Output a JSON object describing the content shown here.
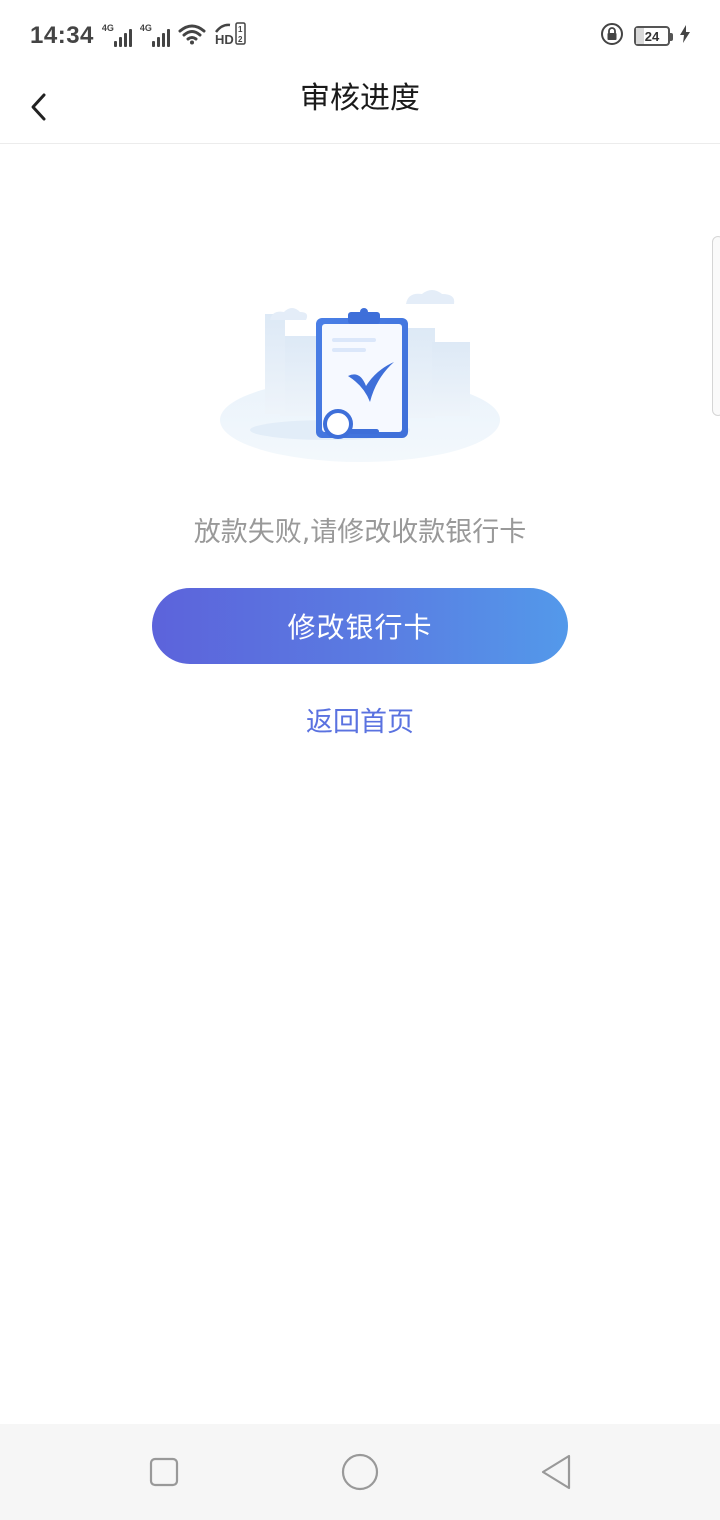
{
  "status_bar": {
    "time": "14:34",
    "network_1": "4G",
    "network_2": "4G",
    "battery_level": "24",
    "icons": [
      "signal-icon",
      "signal-icon",
      "wifi-icon",
      "hd-icon",
      "lock-icon",
      "battery-icon",
      "charging-icon"
    ]
  },
  "nav": {
    "title": "审核进度",
    "back_icon": "chevron-left-icon"
  },
  "content": {
    "illustration": "clipboard-rejected-illustration",
    "message": "放款失败,请修改收款银行卡",
    "primary_button_label": "修改银行卡",
    "secondary_link_label": "返回首页"
  },
  "system_nav": {
    "items": [
      "recent-apps-icon",
      "home-icon",
      "back-icon"
    ]
  },
  "colors": {
    "button_gradient_start": "#5c63db",
    "button_gradient_end": "#5399ea",
    "link": "#5a72e0",
    "message_text": "#999999"
  }
}
